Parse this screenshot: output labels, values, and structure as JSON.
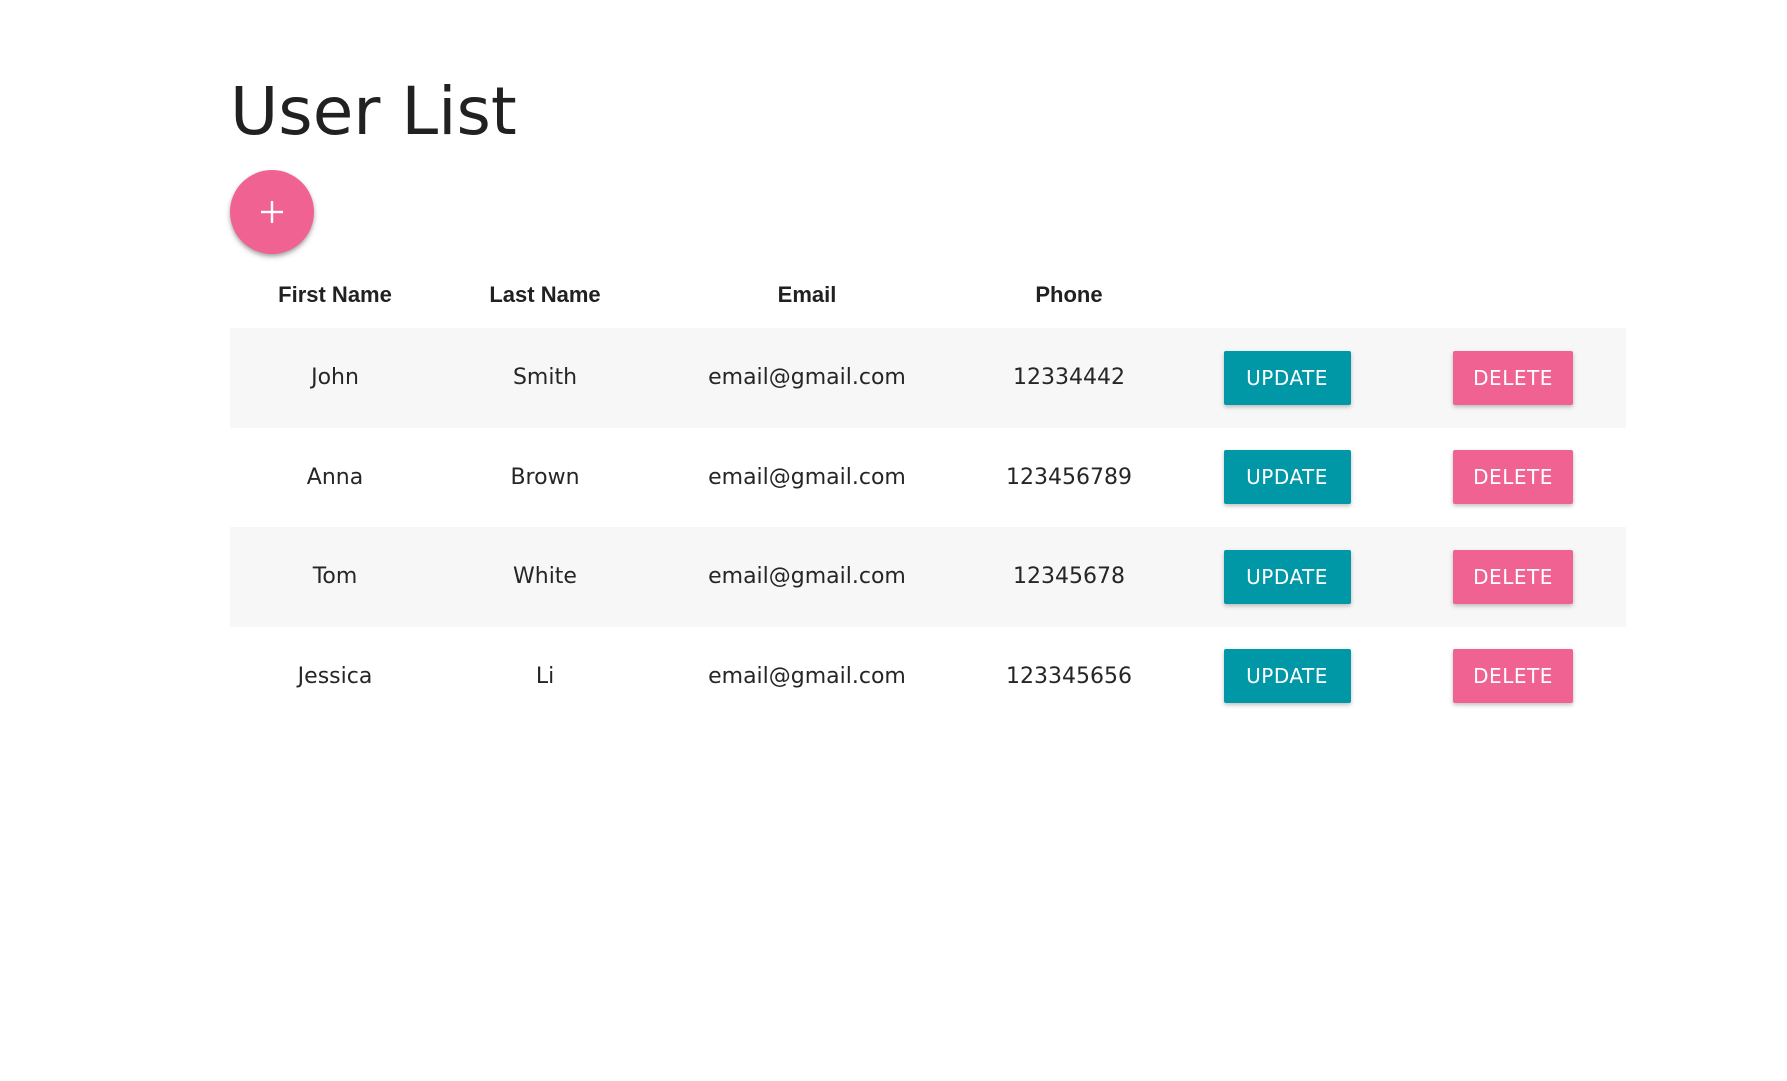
{
  "page": {
    "title": "User List"
  },
  "add_button": {
    "icon": "plus-icon",
    "color": "#f06292"
  },
  "table": {
    "columns": [
      "First Name",
      "Last Name",
      "Email",
      "Phone"
    ],
    "rows": [
      {
        "first_name": "John",
        "last_name": "Smith",
        "email": "email@gmail.com",
        "phone": "12334442"
      },
      {
        "first_name": "Anna",
        "last_name": "Brown",
        "email": "email@gmail.com",
        "phone": "123456789"
      },
      {
        "first_name": "Tom",
        "last_name": "White",
        "email": "email@gmail.com",
        "phone": "12345678"
      },
      {
        "first_name": "Jessica",
        "last_name": "Li",
        "email": "email@gmail.com",
        "phone": "123345656"
      }
    ],
    "update_label": "UPDATE",
    "delete_label": "DELETE"
  },
  "colors": {
    "update": "#0097a7",
    "delete": "#f06292",
    "stripe": "#f7f7f7"
  }
}
